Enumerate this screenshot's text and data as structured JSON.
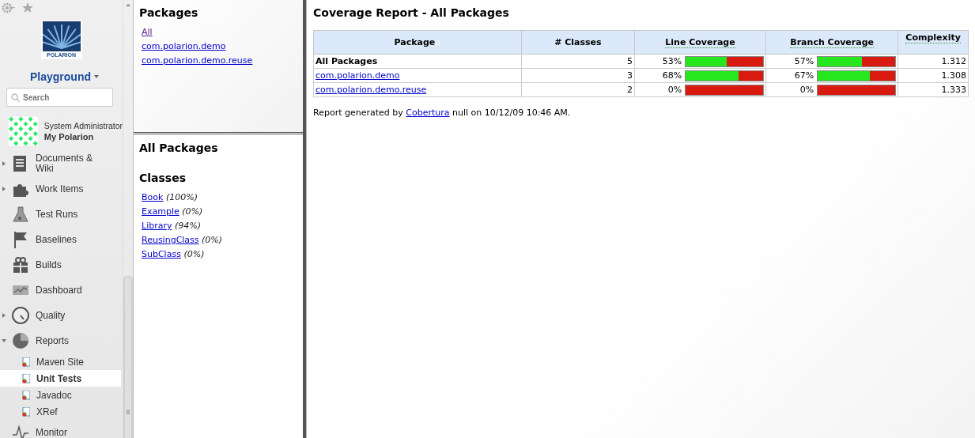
{
  "sidebar": {
    "logo_text": "POLARION",
    "project": "Playground",
    "search": {
      "placeholder": "Search"
    },
    "user": {
      "role": "System Administrator",
      "link": "My Polarion"
    },
    "nav": [
      {
        "label": "Documents & Wiki",
        "kind": "document",
        "expandable": true,
        "expanded": false
      },
      {
        "label": "Work Items",
        "kind": "puzzle",
        "expandable": true,
        "expanded": false
      },
      {
        "label": "Test Runs",
        "kind": "flask",
        "expandable": false,
        "expanded": false
      },
      {
        "label": "Baselines",
        "kind": "flag",
        "expandable": false,
        "expanded": false
      },
      {
        "label": "Builds",
        "kind": "gift",
        "expandable": false,
        "expanded": false
      },
      {
        "label": "Dashboard",
        "kind": "chart",
        "expandable": false,
        "expanded": false
      },
      {
        "label": "Quality",
        "kind": "gauge",
        "expandable": true,
        "expanded": false
      },
      {
        "label": "Reports",
        "kind": "pie",
        "expandable": true,
        "expanded": true,
        "children": [
          {
            "label": "Maven Site",
            "selected": false
          },
          {
            "label": "Unit Tests",
            "selected": true
          },
          {
            "label": "Javadoc",
            "selected": false
          },
          {
            "label": "XRef",
            "selected": false
          }
        ]
      },
      {
        "label": "Monitor",
        "kind": "pulse",
        "expandable": false,
        "expanded": false
      }
    ]
  },
  "packages_frame": {
    "title": "Packages",
    "links": [
      {
        "label": "All",
        "visited": true
      },
      {
        "label": "com.polarion.demo",
        "visited": false
      },
      {
        "label": "com.polarion.demo.reuse",
        "visited": false
      }
    ]
  },
  "classes_frame": {
    "package_title": "All Packages",
    "title": "Classes",
    "classes": [
      {
        "name": "Book",
        "coverage": "(100%)"
      },
      {
        "name": "Example",
        "coverage": "(0%)"
      },
      {
        "name": "Library",
        "coverage": "(94%)"
      },
      {
        "name": "ReusingClass",
        "coverage": "(0%)"
      },
      {
        "name": "SubClass",
        "coverage": "(0%)"
      }
    ]
  },
  "report": {
    "title": "Coverage Report - All Packages",
    "columns": [
      {
        "label": "Package",
        "sorted": true
      },
      {
        "label": "# Classes",
        "sorted": false
      },
      {
        "label": "Line Coverage",
        "sorted": false
      },
      {
        "label": "Branch Coverage",
        "sorted": false
      },
      {
        "label": "Complexity",
        "sorted": false
      }
    ],
    "rows": [
      {
        "package": "All Packages",
        "link": false,
        "classes": "5",
        "line_coverage": {
          "reading": "53%",
          "level": 0.53
        },
        "branch_coverage": {
          "reading": "57%",
          "level": 0.57
        },
        "complexity": "1.312"
      },
      {
        "package": "com.polarion.demo",
        "link": true,
        "classes": "3",
        "line_coverage": {
          "reading": "68%",
          "level": 0.68
        },
        "branch_coverage": {
          "reading": "67%",
          "level": 0.67
        },
        "complexity": "1.308"
      },
      {
        "package": "com.polarion.demo.reuse",
        "link": true,
        "classes": "2",
        "line_coverage": {
          "reading": "0%",
          "level": 0
        },
        "branch_coverage": {
          "reading": "0%",
          "level": 0
        },
        "complexity": "1.333"
      }
    ],
    "footer": {
      "before": "Report generated by",
      "link": "Cobertura",
      "after": "null on 10/12/09 10:46 AM."
    }
  }
}
